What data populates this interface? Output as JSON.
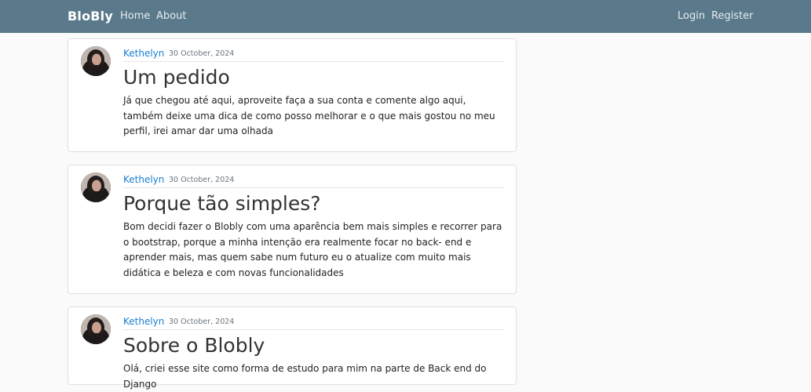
{
  "navbar": {
    "brand": "BloBly",
    "left_links": [
      "Home",
      "About"
    ],
    "right_links": [
      "Login",
      "Register"
    ],
    "background": "#5a7a8c"
  },
  "posts": [
    {
      "author": "Kethelyn",
      "date": "30 October, 2024",
      "title": "Um pedido",
      "body": "Já que chegou até aqui, aproveite faça a sua conta e comente algo aqui, também deixe uma dica de como posso melhorar e o que mais gostou no meu perfil, irei amar dar uma olhada"
    },
    {
      "author": "Kethelyn",
      "date": "30 October, 2024",
      "title": "Porque tão simples?",
      "body": "Bom decidi fazer o Blobly com uma aparência bem mais simples e recorrer para o bootstrap, porque a minha intenção era realmente focar no back- end e aprender mais, mas quem sabe num futuro eu o atualize com muito mais didática e beleza e com novas funcionalidades"
    },
    {
      "author": "Kethelyn",
      "date": "30 October, 2024",
      "title": "Sobre o Blobly",
      "body": "Olá, criei esse site como forma de estudo para mim na parte de Back end do Django"
    }
  ],
  "colors": {
    "author_link": "#1a7fd0",
    "page_background": "#fafafa"
  }
}
